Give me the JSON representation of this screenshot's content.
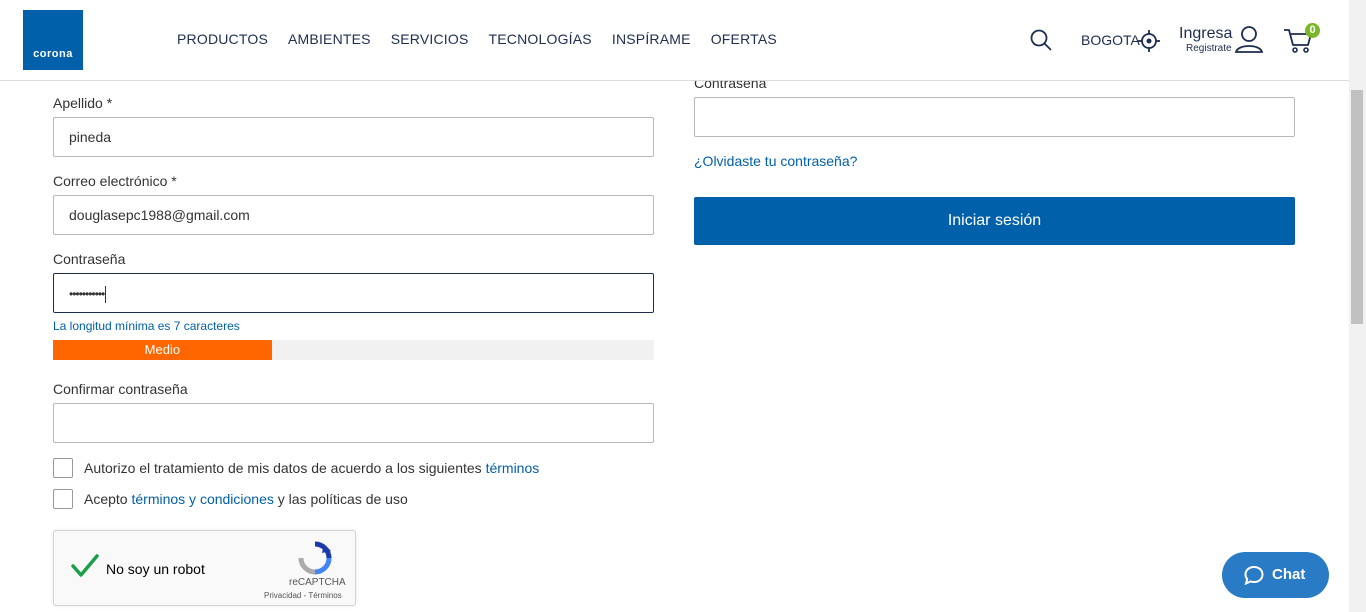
{
  "header": {
    "logo_text": "corona",
    "nav": [
      "PRODUCTOS",
      "AMBIENTES",
      "SERVICIOS",
      "TECNOLOGÍAS",
      "INSPÍRAME",
      "OFERTAS"
    ],
    "city": "BOGOTA",
    "login": "Ingresa",
    "register": "Registrate",
    "cart_count": "0",
    "icons": [
      "search-icon",
      "locate-icon",
      "user-icon",
      "cart-icon"
    ]
  },
  "register_form": {
    "lastname_label": "Apellido *",
    "lastname_value": "pineda",
    "email_label": "Correo electrónico *",
    "email_value": "douglasepc1988@gmail.com",
    "password_label": "Contraseña",
    "password_value": "•••••••••••",
    "password_hint": "La longitud mínima es 7 caracteres",
    "strength_label": "Medio",
    "strength_fraction": 0.364,
    "confirm_label": "Confirmar contraseña",
    "consent_text": "Autorizo el tratamiento de mis datos de acuerdo a los siguientes ",
    "consent_link": "términos",
    "accept_prefix": "Acepto ",
    "accept_link": "términos y condiciones",
    "accept_suffix": " y las políticas de uso",
    "recaptcha": {
      "label": "No soy un robot",
      "brand": "reCAPTCHA",
      "links": "Privacidad - Términos"
    }
  },
  "login_form": {
    "password_label": "Contraseña",
    "forgot_link": "¿Olvidaste tu contraseña?",
    "submit": "Iniciar sesión"
  },
  "chat": {
    "label": "Chat"
  },
  "colors": {
    "brand_blue": "#0060a9",
    "strength_orange": "#ff6600",
    "badge_green": "#7ab727"
  }
}
